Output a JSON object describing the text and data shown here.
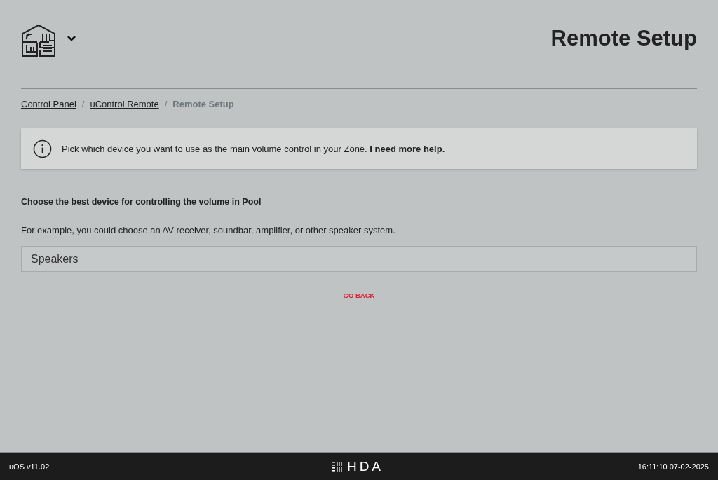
{
  "header": {
    "title": "Remote Setup"
  },
  "breadcrumbs": [
    {
      "label": "Control Panel",
      "current": false
    },
    {
      "separator": "/",
      "label": "uControl Remote",
      "current": false
    },
    {
      "separator": "/",
      "label": "Remote Setup",
      "current": true
    }
  ],
  "info": {
    "text": "Pick which device you want to use as the main volume control in your Zone.",
    "link": "I need more help."
  },
  "heading": "Choose the best device for controlling the volume in Pool",
  "description": "For example, you could choose an AV receiver, soundbar, amplifier, or other speaker system.",
  "devices": [
    {
      "label": "Speakers"
    }
  ],
  "back_button": "GO BACK",
  "footer": {
    "version": "uOS v11.02",
    "brand": "HDA",
    "datetime": "16:11:10 07-02-2025"
  }
}
